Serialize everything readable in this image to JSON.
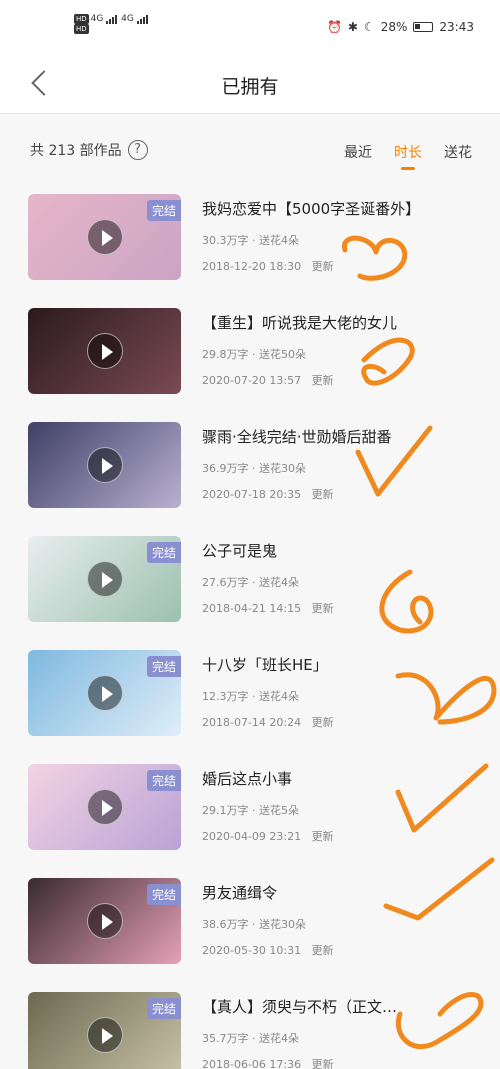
{
  "status_bar": {
    "left_badges": [
      "HD",
      "HD"
    ],
    "network_1": "4G",
    "network_2": "4G",
    "battery": "28%",
    "time": "23:43"
  },
  "nav": {
    "title": "已拥有"
  },
  "filter": {
    "count_label": "共 213 部作品",
    "help_icon": "?",
    "sort_options": [
      "最近",
      "时长",
      "送花"
    ],
    "active_sort": "时长"
  },
  "works": [
    {
      "title": "我妈恋爱中【5000字圣诞番外】",
      "meta": "30.3万字 · 送花4朵",
      "date": "2018-12-20 18:30",
      "update": "更新",
      "badge": "完结",
      "colors": [
        "#e7b6c8",
        "#caa4c4"
      ]
    },
    {
      "title": "【重生】听说我是大佬的女儿",
      "meta": "29.8万字 · 送花50朵",
      "date": "2020-07-20 13:57",
      "update": "更新",
      "badge": "",
      "colors": [
        "#2a1a1e",
        "#7b4a54"
      ]
    },
    {
      "title": "骤雨·全线完结·世勋婚后甜番",
      "meta": "36.9万字 · 送花30朵",
      "date": "2020-07-18 20:35",
      "update": "更新",
      "badge": "",
      "colors": [
        "#3f3f66",
        "#b8b0d0"
      ]
    },
    {
      "title": "公子可是鬼",
      "meta": "27.6万字 · 送花4朵",
      "date": "2018-04-21 14:15",
      "update": "更新",
      "badge": "完结",
      "colors": [
        "#e8eeee",
        "#9cc0b0"
      ]
    },
    {
      "title": "十八岁「班长HE」",
      "meta": "12.3万字 · 送花4朵",
      "date": "2018-07-14 20:24",
      "update": "更新",
      "badge": "完结",
      "colors": [
        "#7fb8e0",
        "#dfeef8"
      ]
    },
    {
      "title": "婚后这点小事",
      "meta": "29.1万字 · 送花5朵",
      "date": "2020-04-09 23:21",
      "update": "更新",
      "badge": "完结",
      "colors": [
        "#f3d3e3",
        "#b9a3d6"
      ]
    },
    {
      "title": "男友通缉令",
      "meta": "38.6万字 · 送花30朵",
      "date": "2020-05-30 10:31",
      "update": "更新",
      "badge": "完结",
      "colors": [
        "#3a2a30",
        "#e5a0b6"
      ]
    },
    {
      "title": "【真人】须臾与不朽（正文…",
      "meta": "35.7万字 · 送花4朵",
      "date": "2018-06-06 17:36",
      "update": "更新",
      "badge": "完结",
      "colors": [
        "#6a6a50",
        "#c9c2a8"
      ]
    }
  ],
  "accent": "#f08300"
}
